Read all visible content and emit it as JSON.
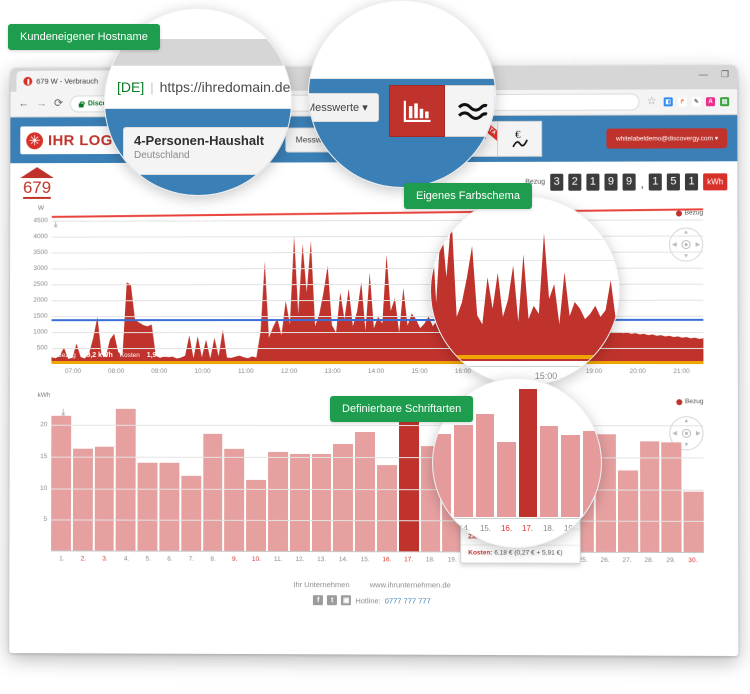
{
  "callouts": [
    {
      "id": "hostname",
      "label": "Kundeneigener Hostname"
    },
    {
      "id": "colors",
      "label": "Eigenes Farbschema"
    },
    {
      "id": "fonts",
      "label": "Definierbare Schriftarten"
    }
  ],
  "browser": {
    "tab_title": "679 W - Verbrauch",
    "back": "←",
    "forward": "→",
    "reload": "⟳",
    "omnibox_secure": "Discovergy",
    "omnibox_url": "https://ihredomain.de",
    "window_minimize": "—",
    "window_maximize": "❐",
    "star_icon": "☆",
    "extensions": [
      {
        "name": "ext-blue",
        "glyph": "◧",
        "color": "#2d8cf0"
      },
      {
        "name": "ext-orange",
        "glyph": "↱",
        "color": "#e8743b"
      },
      {
        "name": "ext-pen",
        "glyph": "✎",
        "color": "#777777"
      },
      {
        "name": "ext-pink",
        "glyph": "A",
        "color": "#e8318a"
      },
      {
        "name": "ext-green",
        "glyph": "▤",
        "color": "#3aa23a"
      }
    ]
  },
  "lens": {
    "url_de": "[DE]",
    "url_pipe": "|",
    "url_text": "https://ihredomain.de",
    "household_title": "4-Personen-Haushalt",
    "household_sub": "Deutschland",
    "messwerte": "Messwerte ▾",
    "beta": "BETA"
  },
  "app": {
    "logo_text": "IHR LOGO",
    "household_title": "4-Personen-Haushalt",
    "household_sub": "Deutschland",
    "messwerte_label": "Messwerte ▾",
    "modes": [
      {
        "name": "mode-bars",
        "glyph": "▥",
        "active": true,
        "beta": ""
      },
      {
        "name": "mode-waves",
        "glyph": "≈",
        "active": false,
        "beta": ""
      },
      {
        "name": "mode-lightbulb",
        "glyph": "☀",
        "active": false,
        "beta": "BETA"
      },
      {
        "name": "mode-euro",
        "glyph": "€",
        "active": false,
        "beta": ""
      }
    ],
    "user_email": "whitelabeldemo@discovergy.com ▾",
    "house_number": "679",
    "meter": {
      "label": "Bezug",
      "digits": [
        "3",
        "2",
        "1",
        "9",
        "9"
      ],
      "separator": ",",
      "decimals": [
        "1",
        "5",
        "1"
      ],
      "unit": "kWh"
    }
  },
  "chart_data": [
    {
      "type": "area",
      "id": "power-chart",
      "title": "",
      "ylabel": "W",
      "xlabel": "",
      "ylim": [
        0,
        4750
      ],
      "yticks": [
        500,
        1000,
        1500,
        2000,
        2500,
        3000,
        3500,
        4000,
        4500
      ],
      "ytick_labels": [
        "500",
        "1000",
        "1500",
        "2000",
        "2500",
        "3000",
        "3500",
        "4000",
        "4500"
      ],
      "xticks": [
        "07:00",
        "08:00",
        "09:00",
        "10:00",
        "11:00",
        "12:00",
        "13:00",
        "14:00",
        "15:00",
        "16:00",
        "17:00",
        "18:00",
        "19:00",
        "20:00",
        "21:00"
      ],
      "legend": [
        {
          "label": "Bezug",
          "color": "#c0332c"
        }
      ],
      "grid": true,
      "inline_legend": {
        "bezug_label": "Bezug",
        "bezug_value": "39,2 kWh",
        "kosten_label": "Kosten",
        "kosten_value": "1,96 €"
      },
      "reference_lines": [
        {
          "name": "max-line",
          "color": "#e8423b",
          "value": 4750
        },
        {
          "name": "avg-line",
          "color": "#3a6fd8",
          "value": 1400
        },
        {
          "name": "base-line",
          "color": "#f0a400",
          "value": 60
        }
      ],
      "values": [
        210,
        180,
        260,
        520,
        160,
        190,
        640,
        220,
        170,
        330,
        820,
        1480,
        300,
        210,
        760,
        950,
        380,
        240,
        2560,
        2490,
        1380,
        1300,
        1220,
        1180,
        1240,
        260,
        190,
        240,
        210,
        230,
        170,
        200,
        260,
        900,
        180,
        870,
        210,
        760,
        170,
        820,
        240,
        1080,
        200,
        190,
        230,
        260,
        210,
        180,
        240,
        200,
        1000,
        3220,
        820,
        1160,
        1420,
        900,
        1980,
        1240,
        4020,
        1560,
        3760,
        2240,
        3860,
        1180,
        1560,
        2240,
        3080,
        1220,
        980,
        2240,
        1400,
        2360,
        1180,
        1640,
        2560,
        1040,
        2860,
        1120,
        1480,
        1260,
        3420,
        1660,
        2060,
        980,
        2380,
        1200,
        1580,
        1400,
        1120,
        1260,
        1480,
        1180,
        1360,
        2160,
        1100,
        1280,
        1420,
        1340,
        1180,
        1260,
        1580,
        1120,
        1360,
        1260,
        1180,
        1140,
        1240,
        1180,
        1160,
        1200,
        1140,
        1180,
        1120,
        1100,
        1180,
        1140,
        1160,
        1180,
        1120,
        1160,
        1140,
        1100,
        1080,
        1120,
        1080,
        1060,
        1100,
        1080,
        1040,
        1060,
        1020,
        1040,
        1000,
        1020,
        980,
        1000,
        960,
        980,
        940,
        960,
        920,
        940,
        900,
        920,
        880,
        900,
        860,
        880,
        840,
        860,
        820,
        840,
        800,
        820,
        780,
        800
      ]
    },
    {
      "type": "bar",
      "id": "daily-chart",
      "ylabel": "kWh",
      "ylim": [
        0,
        24
      ],
      "yticks": [
        5,
        10,
        15,
        20
      ],
      "ytick_labels": [
        "5",
        "10",
        "15",
        "20"
      ],
      "legend": [
        {
          "label": "Bezug",
          "color": "#c0332c"
        }
      ],
      "grid": true,
      "categories": [
        "1.",
        "2.",
        "3.",
        "4.",
        "5.",
        "6.",
        "7.",
        "8.",
        "9.",
        "10.",
        "11.",
        "12.",
        "13.",
        "14.",
        "15.",
        "16.",
        "17.",
        "18.",
        "19.",
        "20.",
        "21.",
        "22.",
        "23.",
        "24.",
        "25.",
        "26.",
        "27.",
        "28.",
        "29.",
        "30."
      ],
      "weekend_indices": [
        1,
        2,
        8,
        9,
        15,
        16,
        22,
        23,
        29
      ],
      "selected_index": 16,
      "values": [
        21.4,
        16.2,
        16.6,
        22.6,
        14.0,
        14.0,
        12.0,
        18.6,
        16.2,
        11.4,
        15.8,
        15.4,
        15.4,
        17.0,
        19.0,
        13.8,
        23.6,
        16.8,
        15.2,
        15.8,
        18.4,
        15.0,
        17.0,
        22.0,
        18.4,
        18.6,
        13.0,
        17.6,
        17.4,
        9.6
      ]
    }
  ],
  "tooltip": {
    "bezug_label": "Bezug:",
    "bezug_value": "23,6 kWh",
    "zaehler_label": "Zählerstand:",
    "zaehler_value": "31 936 kWh",
    "kosten_label": "Kosten:",
    "kosten_value": "6,18 € (0,27 € + 5,91 €)"
  },
  "footer": {
    "company": "Ihr Unternehmen",
    "website": "www.ihrunternehmen.de",
    "social": [
      {
        "name": "facebook-icon",
        "glyph": "f"
      },
      {
        "name": "twitter-icon",
        "glyph": "t"
      },
      {
        "name": "rss-icon",
        "glyph": "▣"
      }
    ],
    "hotline_label": "Hotline:",
    "hotline_number": "0777 777 777"
  }
}
